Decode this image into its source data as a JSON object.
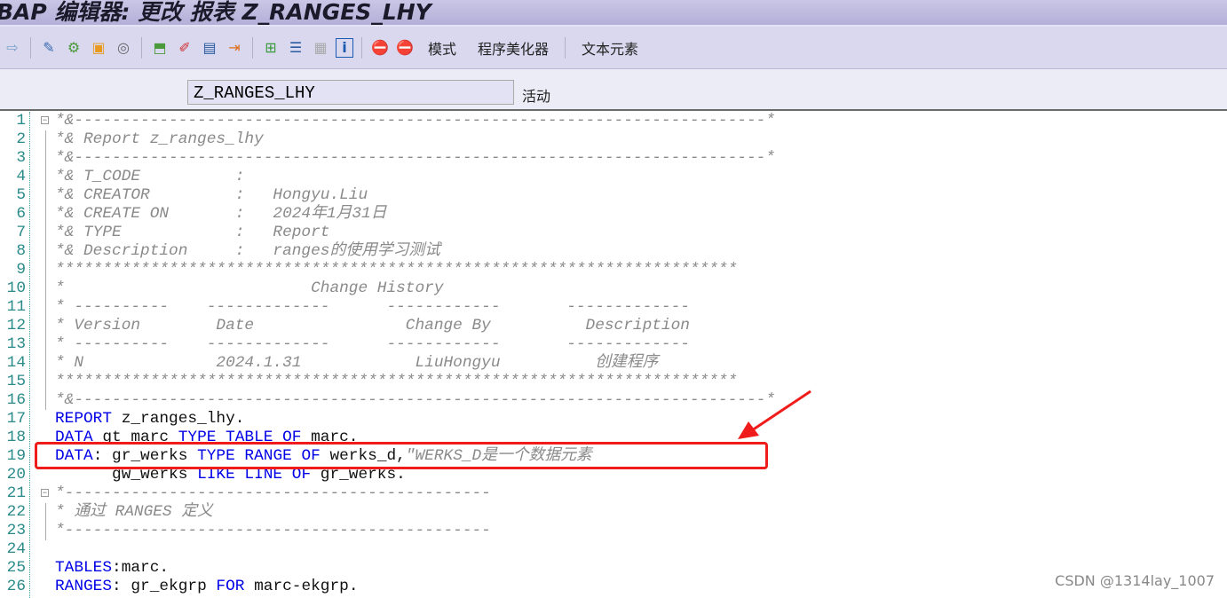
{
  "window": {
    "title": "BAP 编辑器: 更改 报表 Z_RANGES_LHY"
  },
  "toolbar": {
    "icons": [
      "forward-icon",
      "display-change-icon",
      "activate-icon",
      "other-object-icon",
      "where-used-icon",
      "syntax-check-icon",
      "test-icon",
      "breakpoint-icon",
      "move-icon",
      "object-list-icon",
      "navigation-icon",
      "list-icon",
      "info-icon",
      "stop-icon",
      "session-stop-icon"
    ],
    "buttons": [
      "模式",
      "程序美化器",
      "文本元素"
    ]
  },
  "program": {
    "name": "Z_RANGES_LHY",
    "status": "活动"
  },
  "colors": {
    "keyword": "#0000e6",
    "comment": "#8a8a8a",
    "highlight": "#f01c1c",
    "linenum": "#2a8a8a"
  },
  "code_lines": [
    [
      [
        "c",
        "*&-------------------------------------------------------------------------*"
      ]
    ],
    [
      [
        "c",
        "*& Report z_ranges_lhy"
      ]
    ],
    [
      [
        "c",
        "*&-------------------------------------------------------------------------*"
      ]
    ],
    [
      [
        "c",
        "*& T_CODE          :"
      ]
    ],
    [
      [
        "c",
        "*& CREATOR         :   Hongyu.Liu"
      ]
    ],
    [
      [
        "c",
        "*& CREATE ON       :   2024年1月31日"
      ]
    ],
    [
      [
        "c",
        "*& TYPE            :   Report"
      ]
    ],
    [
      [
        "c",
        "*& Description     :   ranges的使用学习测试"
      ]
    ],
    [
      [
        "c",
        "************************************************************************"
      ]
    ],
    [
      [
        "c",
        "*                          Change History"
      ]
    ],
    [
      [
        "c",
        "* ----------    -------------      ------------       -------------"
      ]
    ],
    [
      [
        "c",
        "* Version        Date                Change By          Description"
      ]
    ],
    [
      [
        "c",
        "* ----------    -------------      ------------       -------------"
      ]
    ],
    [
      [
        "c",
        "* N              2024.1.31            LiuHongyu          创建程序"
      ]
    ],
    [
      [
        "c",
        "************************************************************************"
      ]
    ],
    [
      [
        "c",
        "*&-------------------------------------------------------------------------*"
      ]
    ],
    [
      [
        "k",
        "REPORT"
      ],
      [
        "t",
        " z_ranges_lhy."
      ]
    ],
    [
      [
        "k",
        "DATA"
      ],
      [
        "t",
        " gt_marc "
      ],
      [
        "k",
        "TYPE TABLE OF"
      ],
      [
        "t",
        " marc."
      ]
    ],
    [
      [
        "k",
        "DATA"
      ],
      [
        "t",
        ": gr_werks "
      ],
      [
        "k",
        "TYPE RANGE OF"
      ],
      [
        "t",
        " werks_d,"
      ],
      [
        "c",
        "\"WERKS_D是一个数据元素"
      ]
    ],
    [
      [
        "t",
        "      gw_werks "
      ],
      [
        "k",
        "LIKE LINE OF"
      ],
      [
        "t",
        " gr_werks."
      ]
    ],
    [
      [
        "c",
        "*---------------------------------------------"
      ]
    ],
    [
      [
        "c",
        "* 通过 RANGES 定义"
      ]
    ],
    [
      [
        "c",
        "*---------------------------------------------"
      ]
    ],
    [],
    [
      [
        "k",
        "TABLES"
      ],
      [
        "t",
        ":marc."
      ]
    ],
    [
      [
        "k",
        "RANGES"
      ],
      [
        "t",
        ": gr_ekgrp "
      ],
      [
        "k",
        "FOR"
      ],
      [
        "t",
        " marc-ekgrp."
      ]
    ]
  ],
  "watermark": "CSDN @1314lay_1007"
}
